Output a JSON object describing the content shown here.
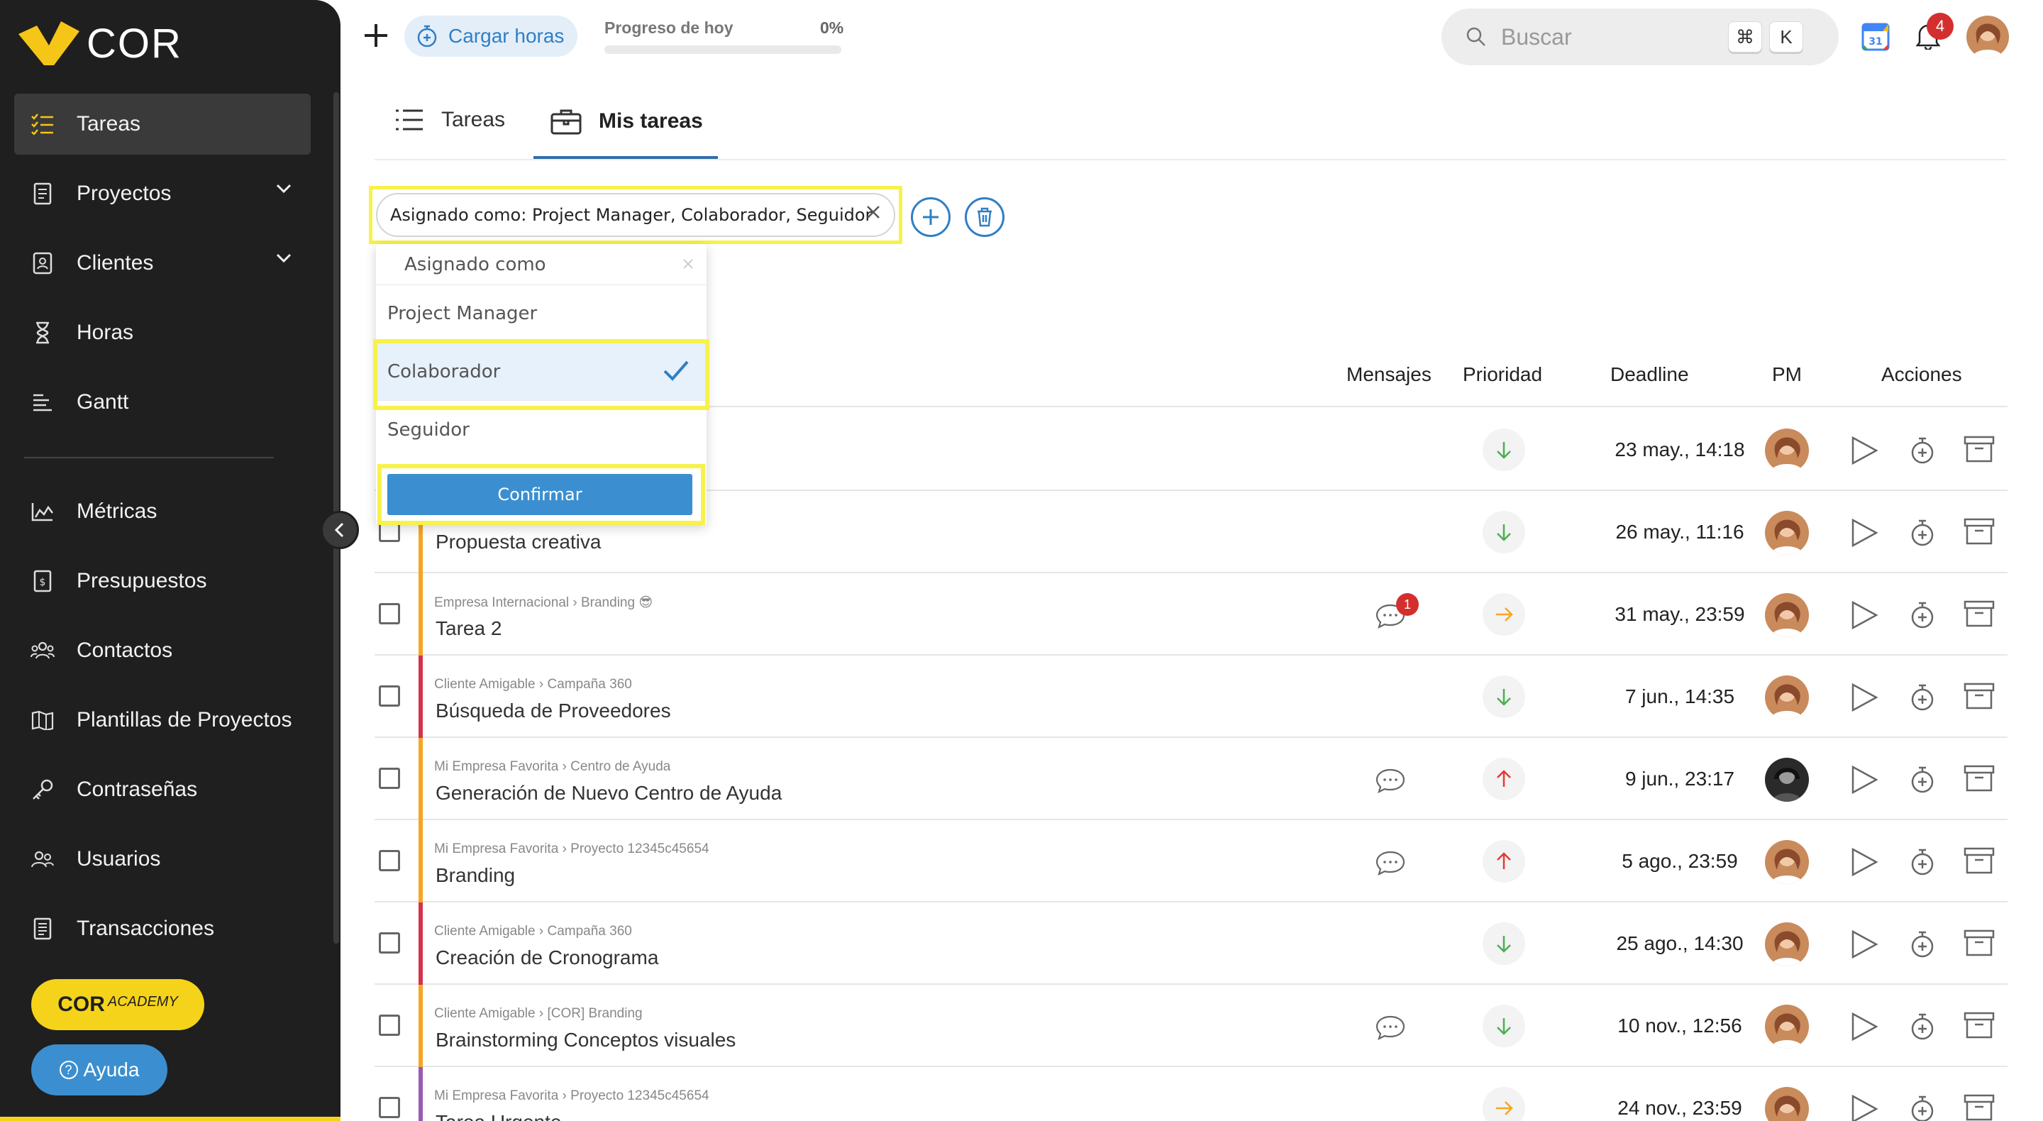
{
  "sidebar": {
    "logo": "COR",
    "items": [
      {
        "label": "Tareas",
        "icon": "checklist-icon"
      },
      {
        "label": "Proyectos",
        "icon": "document-icon"
      },
      {
        "label": "Clientes",
        "icon": "contact-card-icon"
      },
      {
        "label": "Horas",
        "icon": "hourglass-icon"
      },
      {
        "label": "Gantt",
        "icon": "gantt-icon"
      },
      {
        "label": "Métricas",
        "icon": "chart-icon"
      },
      {
        "label": "Presupuestos",
        "icon": "budget-icon"
      },
      {
        "label": "Contactos",
        "icon": "contacts-icon"
      },
      {
        "label": "Plantillas de Proyectos",
        "icon": "map-icon"
      },
      {
        "label": "Contraseñas",
        "icon": "key-icon"
      },
      {
        "label": "Usuarios",
        "icon": "users-icon"
      },
      {
        "label": "Transacciones",
        "icon": "receipt-icon"
      }
    ],
    "academy": {
      "main": "COR",
      "sub": "ACADEMY"
    },
    "help": "Ayuda"
  },
  "topbar": {
    "cargar": "Cargar horas",
    "progress_label": "Progreso de hoy",
    "progress_pct": "0%",
    "progress_value": 0,
    "search_placeholder": "Buscar",
    "kbd1": "⌘",
    "kbd2": "K",
    "notifications": "4"
  },
  "tabs": [
    {
      "label": "Tareas"
    },
    {
      "label": "Mis tareas"
    }
  ],
  "filter": {
    "chip": "Asignado como: Project Manager, Colaborador, Seguidor"
  },
  "dropdown": {
    "search": "Asignado como",
    "options": [
      "Project Manager",
      "Colaborador",
      "Seguidor"
    ],
    "selected": "Colaborador",
    "confirm": "Confirmar"
  },
  "table": {
    "headers": {
      "mensajes": "Mensajes",
      "prioridad": "Prioridad",
      "deadline": "Deadline",
      "pm": "PM",
      "acciones": "Acciones"
    },
    "rows": [
      {
        "crumb": "",
        "name": "",
        "deadline": "23 may., 14:18",
        "priority": "low",
        "bar": "#e8c7b9",
        "msg": false,
        "badge": ""
      },
      {
        "crumb": "",
        "name": "Propuesta creativa",
        "deadline": "26 may., 11:16",
        "priority": "low",
        "bar": "#f5a623",
        "msg": false,
        "badge": ""
      },
      {
        "crumb": "Empresa Internacional › Branding 😎",
        "name": "Tarea 2",
        "deadline": "31 may., 23:59",
        "priority": "medium",
        "bar": "#f5a623",
        "msg": true,
        "badge": "1"
      },
      {
        "crumb": "Cliente Amigable › Campaña 360",
        "name": "Búsqueda de Proveedores",
        "deadline": "7 jun., 14:35",
        "priority": "low",
        "bar": "#d6314a",
        "msg": false,
        "badge": ""
      },
      {
        "crumb": "Mi Empresa Favorita › Centro de Ayuda",
        "name": "Generación de Nuevo Centro de Ayuda",
        "deadline": "9 jun., 23:17",
        "priority": "high",
        "bar": "#f5a623",
        "msg": true,
        "badge": ""
      },
      {
        "crumb": "Mi Empresa Favorita › Proyecto 12345c45654",
        "name": "Branding",
        "deadline": "5 ago., 23:59",
        "priority": "high",
        "bar": "#f5a623",
        "msg": true,
        "badge": ""
      },
      {
        "crumb": "Cliente Amigable › Campaña 360",
        "name": "Creación de Cronograma",
        "deadline": "25 ago., 14:30",
        "priority": "low",
        "bar": "#d6314a",
        "msg": false,
        "badge": ""
      },
      {
        "crumb": "Cliente Amigable › [COR] Branding",
        "name": "Brainstorming Conceptos visuales",
        "deadline": "10 nov., 12:56",
        "priority": "low",
        "bar": "#f5a623",
        "msg": true,
        "badge": ""
      },
      {
        "crumb": "Mi Empresa Favorita › Proyecto 12345c45654",
        "name": "Tarea Urgente",
        "deadline": "24 nov., 23:59",
        "priority": "medium",
        "bar": "#9b59b6",
        "msg": false,
        "badge": ""
      }
    ]
  },
  "colors": {
    "accent": "#3b8fd0",
    "highlight": "#f7f24a",
    "sidebar": "#1f1f1f",
    "academy": "#f5d31a",
    "danger": "#d32f2f"
  }
}
